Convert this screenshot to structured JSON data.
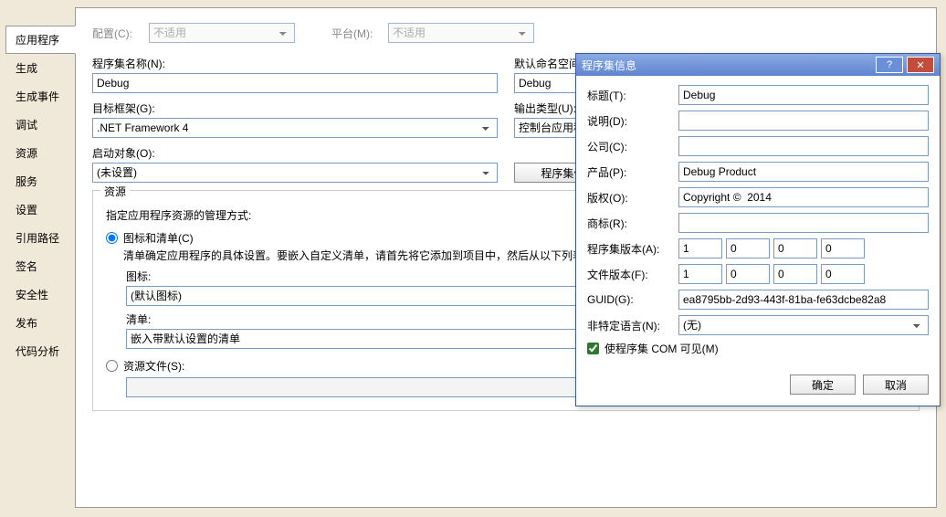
{
  "tabs": [
    "应用程序",
    "生成",
    "生成事件",
    "调试",
    "资源",
    "服务",
    "设置",
    "引用路径",
    "签名",
    "安全性",
    "发布",
    "代码分析"
  ],
  "activeTab": 0,
  "top": {
    "configLabel": "配置(C):",
    "configValue": "不适用",
    "platformLabel": "平台(M):",
    "platformValue": "不适用"
  },
  "app": {
    "assemblyNameLabel": "程序集名称(N):",
    "assemblyName": "Debug",
    "defaultNamespaceLabel": "默认命名空间(L):",
    "defaultNamespace": "Debug",
    "targetFrameworkLabel": "目标框架(G):",
    "targetFramework": ".NET Framework 4",
    "outputTypeLabel": "输出类型(U):",
    "outputType": "控制台应用程序",
    "startupObjectLabel": "启动对象(O):",
    "startupObject": "(未设置)",
    "assemblyInfoButton": "程序集信息(I)..."
  },
  "resources": {
    "groupTitle": "资源",
    "desc": "指定应用程序资源的管理方式:",
    "iconManifestRadio": "图标和清单(C)",
    "iconManifestDesc": "清单确定应用程序的具体设置。要嵌入自定义清单，请首先将它添加到项目中，然后从以下列表中选择它。",
    "iconLabel": "图标:",
    "iconValue": "(默认图标)",
    "browse": "...",
    "manifestLabel": "清单:",
    "manifestValue": "嵌入带默认设置的清单",
    "resourceFileRadio": "资源文件(S):"
  },
  "dialog": {
    "title": "程序集信息",
    "help": "?",
    "close": "✕",
    "titleLabel": "标题(T):",
    "titleVal": "Debug",
    "descLabel": "说明(D):",
    "descVal": "",
    "companyLabel": "公司(C):",
    "companyVal": "",
    "productLabel": "产品(P):",
    "productVal": "Debug Product",
    "copyrightLabel": "版权(O):",
    "copyrightVal": "Copyright ©  2014",
    "trademarkLabel": "商标(R):",
    "trademarkVal": "",
    "asmVerLabel": "程序集版本(A):",
    "asmVer": [
      "1",
      "0",
      "0",
      "0"
    ],
    "fileVerLabel": "文件版本(F):",
    "fileVer": [
      "1",
      "0",
      "0",
      "0"
    ],
    "guidLabel": "GUID(G):",
    "guidVal": "ea8795bb-2d93-443f-81ba-fe63dcbe82a8",
    "langLabel": "非特定语言(N):",
    "langVal": "(无)",
    "comVisibleLabel": "使程序集 COM 可见(M)",
    "comVisible": true,
    "ok": "确定",
    "cancel": "取消"
  }
}
